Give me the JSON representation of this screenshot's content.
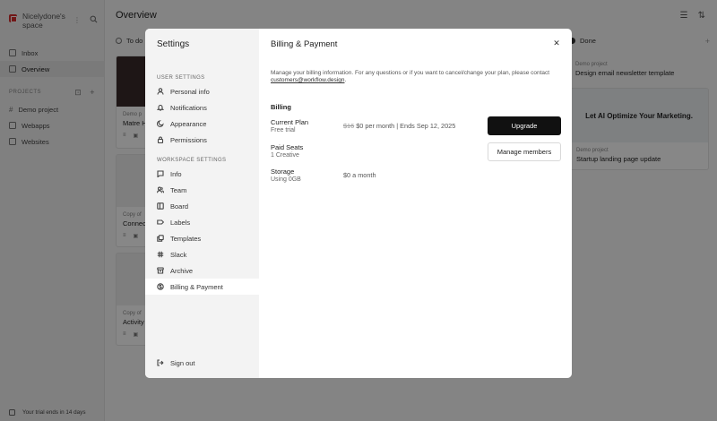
{
  "sidebar": {
    "workspace_name": "Nicelydone's space",
    "nav": [
      {
        "label": "Inbox",
        "icon": "inbox-icon"
      },
      {
        "label": "Overview",
        "icon": "board-icon"
      }
    ],
    "projects_heading": "PROJECTS",
    "projects": [
      {
        "label": "Demo project",
        "icon": "hash-icon"
      },
      {
        "label": "Webapps",
        "icon": "folder-icon"
      },
      {
        "label": "Websites",
        "icon": "folder-icon"
      }
    ],
    "trial_text": "Your trial ends in 14 days"
  },
  "main": {
    "title": "Overview",
    "columns": [
      {
        "label": "To do"
      },
      {
        "label": "Done"
      }
    ],
    "cards_left": [
      {
        "meta": "Demo p",
        "title": "Matre H"
      },
      {
        "meta": "Copy of",
        "title": "Connec"
      },
      {
        "meta": "Copy of",
        "title": "Activity"
      }
    ],
    "cards_right": [
      {
        "meta": "Demo project",
        "title": "Design email newsletter template"
      },
      {
        "meta": "Demo project",
        "title": "Startup landing page update",
        "image_text": "Let AI Optimize Your Marketing."
      }
    ]
  },
  "modal": {
    "title": "Settings",
    "user_settings_heading": "USER SETTINGS",
    "user_settings": [
      {
        "label": "Personal info",
        "icon": "user-icon"
      },
      {
        "label": "Notifications",
        "icon": "bell-icon"
      },
      {
        "label": "Appearance",
        "icon": "moon-icon"
      },
      {
        "label": "Permissions",
        "icon": "lock-icon"
      }
    ],
    "workspace_settings_heading": "WORKSPACE SETTINGS",
    "workspace_settings": [
      {
        "label": "Info",
        "icon": "info-icon"
      },
      {
        "label": "Team",
        "icon": "team-icon"
      },
      {
        "label": "Board",
        "icon": "board-icon"
      },
      {
        "label": "Labels",
        "icon": "label-icon"
      },
      {
        "label": "Templates",
        "icon": "templates-icon"
      },
      {
        "label": "Slack",
        "icon": "slack-icon"
      },
      {
        "label": "Archive",
        "icon": "archive-icon"
      },
      {
        "label": "Billing & Payment",
        "icon": "billing-icon",
        "active": true
      }
    ],
    "sign_out": "Sign out",
    "page": {
      "title": "Billing & Payment",
      "description_prefix": "Manage your billing information. For any questions or if you want to cancel/change your plan, please contact ",
      "contact_email": "customers@workflow.design",
      "description_suffix": ".",
      "billing_heading": "Billing",
      "current_plan": {
        "label": "Current Plan",
        "sub": "Free trial",
        "old_price": "$16",
        "price": "$0 per month",
        "renewal": "| Ends Sep 12, 2025",
        "button": "Upgrade"
      },
      "paid_seats": {
        "label": "Paid Seats",
        "sub": "1 Creative",
        "button": "Manage members"
      },
      "storage": {
        "label": "Storage",
        "sub": "Using 0GB",
        "value": "$0 a month"
      }
    }
  }
}
